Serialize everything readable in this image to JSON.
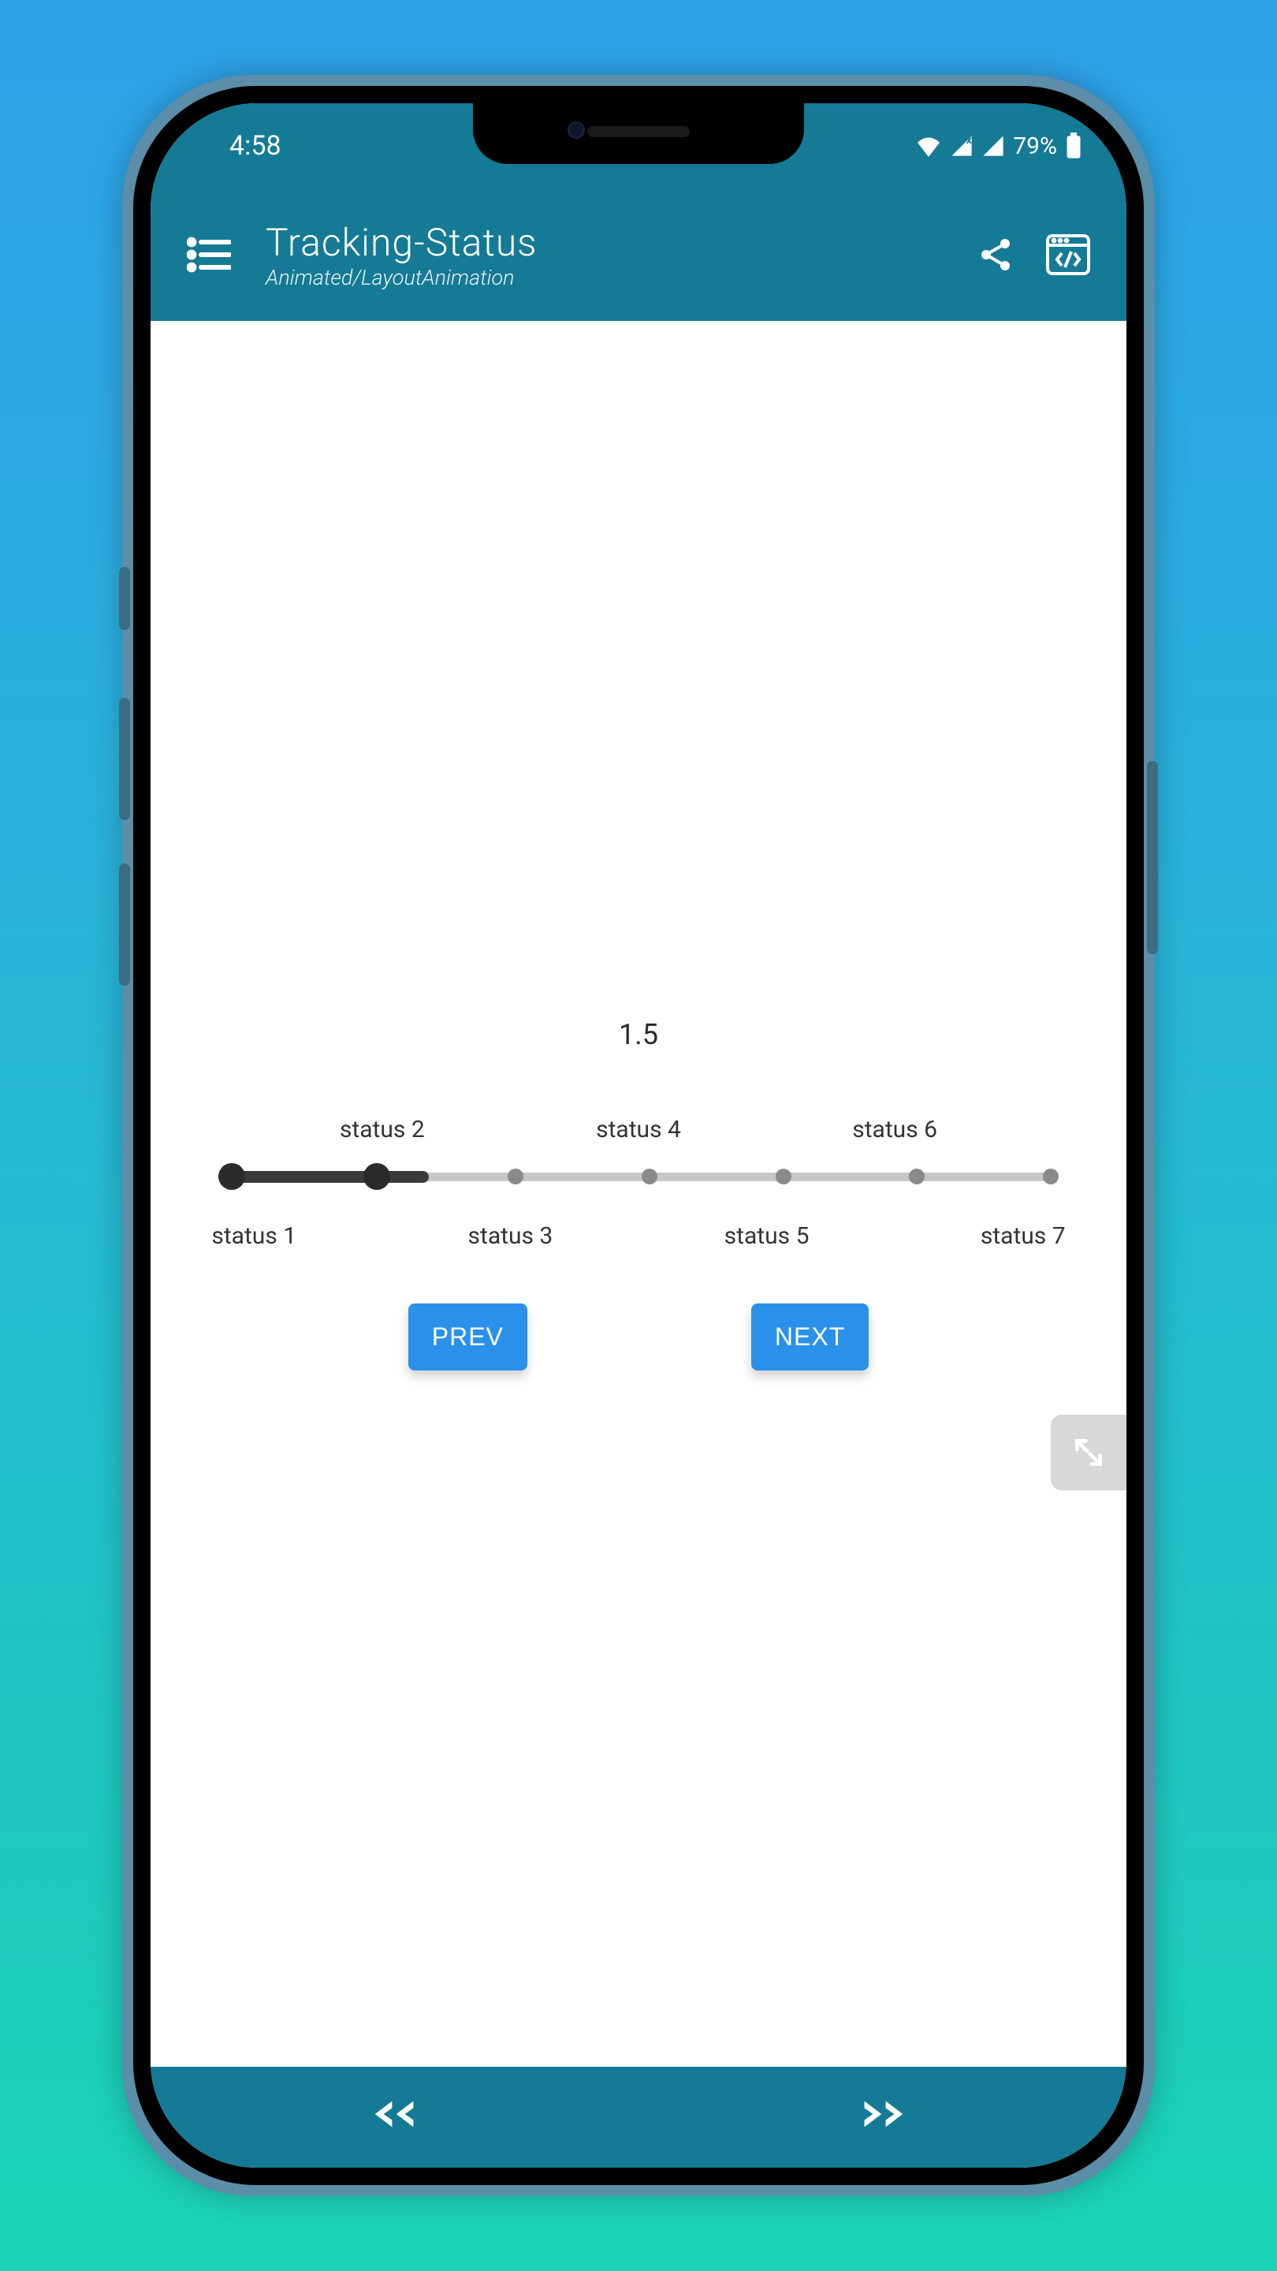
{
  "status_bar": {
    "time": "4:58",
    "battery_percent": "79%"
  },
  "header": {
    "title": "Tracking-Status",
    "subtitle": "Animated/LayoutAnimation"
  },
  "tracker": {
    "value": "1.5",
    "current_step": 1.5,
    "total_steps": 7,
    "steps": [
      {
        "label": "status 1"
      },
      {
        "label": "status 2"
      },
      {
        "label": "status 3"
      },
      {
        "label": "status 4"
      },
      {
        "label": "status 5"
      },
      {
        "label": "status 6"
      },
      {
        "label": "status 7"
      }
    ]
  },
  "buttons": {
    "prev": "PREV",
    "next": "NEXT"
  },
  "colors": {
    "brand": "#157a95",
    "buttonBlue": "#2a91eb",
    "trackInactive": "#c7c7c7",
    "trackActive": "#3a3a3a"
  }
}
